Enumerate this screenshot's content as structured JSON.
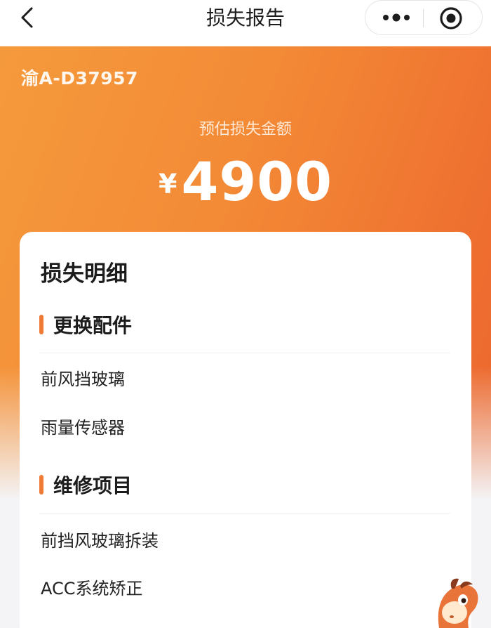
{
  "nav": {
    "title": "损失报告"
  },
  "header": {
    "plate": "渝A-D37957",
    "amount_label": "预估损失金额",
    "currency": "¥",
    "amount": "4900"
  },
  "details": {
    "title": "损失明细",
    "sections": [
      {
        "title": "更换配件",
        "items": [
          "前风挡玻璃",
          "雨量传感器"
        ]
      },
      {
        "title": "维修项目",
        "items": [
          "前挡风玻璃拆装",
          "ACC系统矫正"
        ]
      }
    ]
  },
  "colors": {
    "accent": "#ee7a35",
    "gradient_start": "#f59a3c",
    "gradient_end": "#ea6530"
  },
  "icons": {
    "back": "chevron-left-icon",
    "more": "more-dots-icon",
    "close": "target-close-icon",
    "mascot": "horse-mascot-icon"
  }
}
